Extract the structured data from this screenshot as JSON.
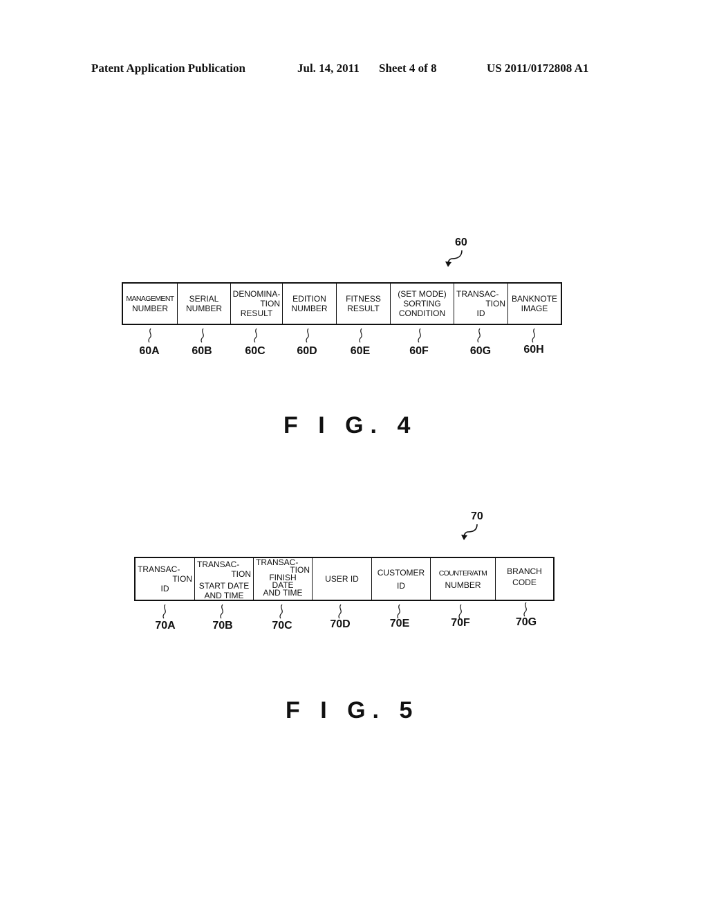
{
  "header": {
    "publication": "Patent Application Publication",
    "date": "Jul. 14, 2011",
    "sheet": "Sheet 4 of 8",
    "patent_number": "US 2011/0172808 A1"
  },
  "fig4": {
    "ref": "60",
    "caption": "F I G. 4",
    "fields": [
      {
        "lines": [
          "MANAGEMENT",
          "NUMBER"
        ],
        "ref": "60A"
      },
      {
        "lines": [
          "SERIAL",
          "NUMBER"
        ],
        "ref": "60B"
      },
      {
        "lines": [
          "DENOMINA-",
          "TION",
          "RESULT"
        ],
        "ref": "60C"
      },
      {
        "lines": [
          "EDITION",
          "NUMBER"
        ],
        "ref": "60D"
      },
      {
        "lines": [
          "FITNESS",
          "RESULT"
        ],
        "ref": "60E"
      },
      {
        "lines": [
          "(SET MODE)",
          "SORTING",
          "CONDITION"
        ],
        "ref": "60F"
      },
      {
        "lines": [
          "TRANSAC-",
          "TION",
          "ID"
        ],
        "ref": "60G"
      },
      {
        "lines": [
          "BANKNOTE",
          "IMAGE"
        ],
        "ref": "60H"
      }
    ]
  },
  "fig5": {
    "ref": "70",
    "caption": "F I G. 5",
    "fields": [
      {
        "lines": [
          "TRANSAC-",
          "TION",
          "ID"
        ],
        "ref": "70A"
      },
      {
        "lines": [
          "TRANSAC-",
          "TION",
          "START DATE",
          "AND TIME"
        ],
        "ref": "70B"
      },
      {
        "lines": [
          "TRANSAC-",
          "TION",
          "FINISH",
          "DATE",
          "AND TIME"
        ],
        "ref": "70C"
      },
      {
        "lines": [
          "USER ID"
        ],
        "ref": "70D"
      },
      {
        "lines": [
          "CUSTOMER",
          "ID"
        ],
        "ref": "70E"
      },
      {
        "lines": [
          "COUNTER/ATM",
          "NUMBER"
        ],
        "ref": "70F"
      },
      {
        "lines": [
          "BRANCH",
          "CODE"
        ],
        "ref": "70G"
      }
    ]
  }
}
